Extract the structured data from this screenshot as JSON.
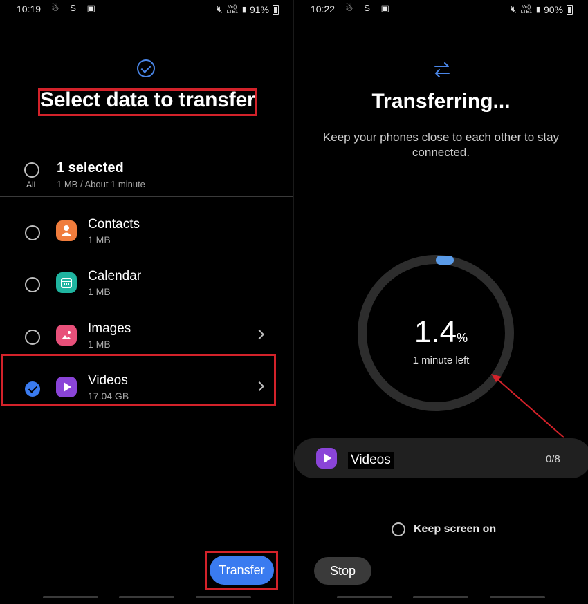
{
  "left_screen": {
    "status": {
      "time": "10:19",
      "left_icons": "☃ S ▣",
      "battery": "91%",
      "volte": "Vo)) LTE1"
    },
    "title": "Select data to transfer",
    "select_all": {
      "summary": "1 selected",
      "detail": "1 MB / About 1 minute",
      "all_label": "All"
    },
    "items": [
      {
        "label": "Contacts",
        "size": "1 MB",
        "icon": "contacts-icon",
        "color": "#f07c3c",
        "checked": false,
        "has_chevron": false
      },
      {
        "label": "Calendar",
        "size": "1 MB",
        "icon": "calendar-icon",
        "color": "#1fb5a0",
        "checked": false,
        "has_chevron": false
      },
      {
        "label": "Images",
        "size": "1 MB",
        "icon": "images-icon",
        "color": "#e8507a",
        "checked": false,
        "has_chevron": true
      },
      {
        "label": "Videos",
        "size": "17.04 GB",
        "icon": "videos-icon",
        "color": "#8a44d8",
        "checked": true,
        "has_chevron": true
      }
    ],
    "transfer_button": "Transfer",
    "highlight_color": "#d3222a"
  },
  "right_screen": {
    "status": {
      "time": "10:22",
      "left_icons": "☃ S ▣",
      "battery": "90%",
      "volte": "Vo)) LTE1"
    },
    "title": "Transferring...",
    "description": "Keep your phones close to each other to stay connected.",
    "progress": {
      "value": "1.4",
      "unit": "%",
      "time_left": "1 minute left",
      "fraction": 0.014
    },
    "current_item": {
      "label": "Videos",
      "count": "0/8"
    },
    "keep_screen_on": {
      "label": "Keep screen on",
      "checked": false
    },
    "stop_button": "Stop",
    "accent_color": "#3a7bf0"
  }
}
